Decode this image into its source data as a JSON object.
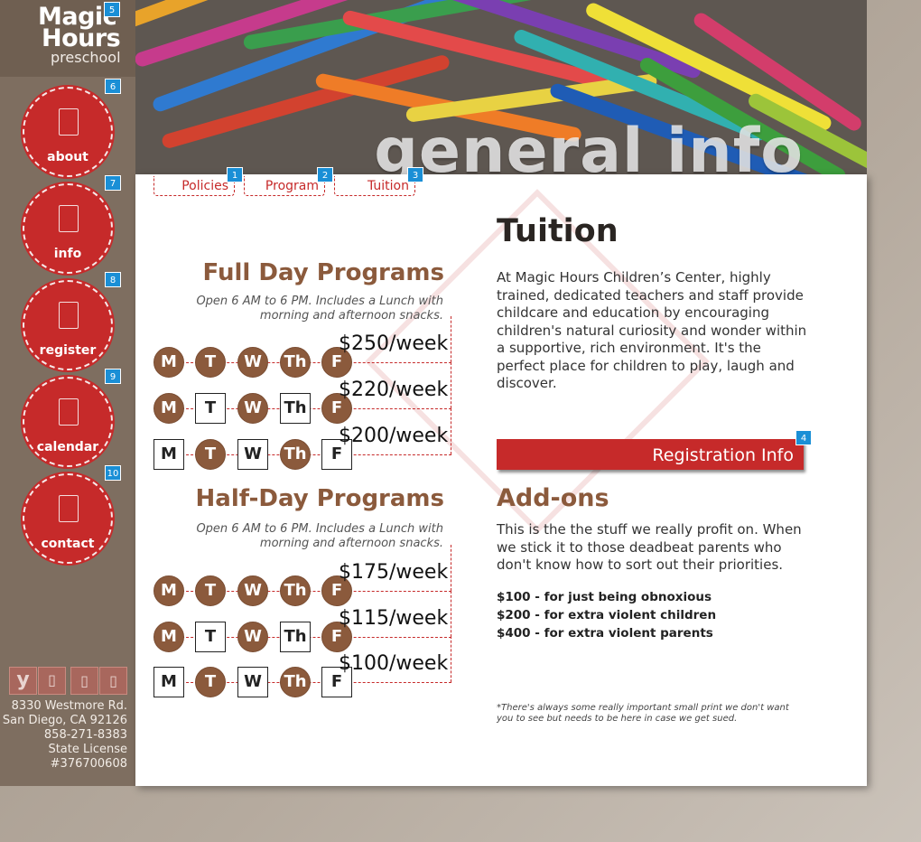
{
  "logo": {
    "line1": "Magic",
    "line2": "Hours",
    "line3": "preschool"
  },
  "hero": {
    "title": "general info"
  },
  "nav": [
    {
      "label": "about",
      "badge": "6",
      "icon": "info-person-icon"
    },
    {
      "label": "info",
      "badge": "7",
      "icon": "document-icon"
    },
    {
      "label": "register",
      "badge": "8",
      "icon": "pencil-icon"
    },
    {
      "label": "calendar",
      "badge": "9",
      "icon": "calendar-icon"
    },
    {
      "label": "contact",
      "badge": "10",
      "icon": "phone-icon"
    }
  ],
  "logo_badge": "5",
  "tabs": [
    {
      "label": "Policies",
      "badge": "1"
    },
    {
      "label": "Program",
      "badge": "2"
    },
    {
      "label": "Tuition",
      "badge": "3"
    }
  ],
  "social": [
    {
      "glyph": "y",
      "icon": "yelp-icon"
    },
    {
      "glyph": "▯",
      "icon": "facebook-icon"
    },
    {
      "glyph": "▯",
      "icon": "twitter-icon"
    },
    {
      "glyph": "▯",
      "icon": "rss-icon"
    }
  ],
  "address": {
    "street": "8330 Westmore Rd.",
    "city": "San Diego, CA 92126",
    "phone": "858-271-8383",
    "license_label": "State License",
    "license_no": "#376700608"
  },
  "full_day": {
    "title": "Full Day Programs",
    "sub1": "Open 6 AM to 6 PM. Includes a Lunch with",
    "sub2": "morning and afternoon snacks.",
    "rows": [
      {
        "price": "$250/week",
        "days": [
          true,
          true,
          true,
          true,
          true
        ]
      },
      {
        "price": "$220/week",
        "days": [
          true,
          false,
          true,
          false,
          true
        ]
      },
      {
        "price": "$200/week",
        "days": [
          false,
          true,
          false,
          true,
          false
        ]
      }
    ]
  },
  "half_day": {
    "title": "Half-Day Programs",
    "sub1": "Open 6 AM to 6 PM. Includes a Lunch with",
    "sub2": "morning and afternoon snacks.",
    "rows": [
      {
        "price": "$175/week",
        "days": [
          true,
          true,
          true,
          true,
          true
        ]
      },
      {
        "price": "$115/week",
        "days": [
          true,
          false,
          true,
          false,
          true
        ]
      },
      {
        "price": "$100/week",
        "days": [
          false,
          true,
          false,
          true,
          false
        ]
      }
    ]
  },
  "day_labels": [
    "M",
    "T",
    "W",
    "Th",
    "F"
  ],
  "tuition": {
    "title": "Tuition",
    "body": "At Magic Hours Children’s Center, highly trained, dedicated teachers and staff provide childcare and education by encouraging children's natural curiosity and wonder within a supportive, rich environment. It's the perfect place for children to play, laugh and discover.",
    "reg_button": "Registration Info",
    "reg_badge": "4"
  },
  "addons": {
    "title": "Add-ons",
    "body": "This is the the stuff we really profit on. When we stick it to those deadbeat parents who don't know how to sort out their priorities.",
    "fees": [
      "$100 - for just being obnoxious",
      "$200 - for extra violent children",
      "$400 - for extra violent parents"
    ],
    "fine_print": "*There's always some really important small print we don't want you to see but needs to be here in case we get sued."
  },
  "colors": {
    "accent": "#c62a2a",
    "brown": "#8b5a3c",
    "badge": "#1a8fd6"
  }
}
